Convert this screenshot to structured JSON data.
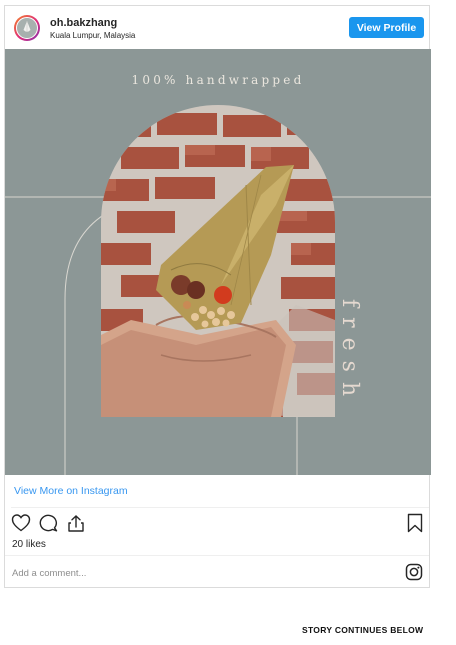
{
  "post": {
    "username": "oh.bakzhang",
    "location": "Kuala Lumpur, Malaysia",
    "view_profile_label": "View Profile",
    "image_text": {
      "tagline": "100% handwrapped",
      "side_word": "fresh"
    },
    "view_more_label": "View More on Instagram",
    "likes": "20 likes",
    "comment_placeholder": "Add a comment..."
  },
  "footer": {
    "story_continues": "STORY CONTINUES BELOW"
  },
  "icons": [
    "heart-icon",
    "comment-icon",
    "share-icon",
    "bookmark-icon",
    "instagram-icon"
  ],
  "colors": {
    "accent": "#1a96ee",
    "link": "#3897f0",
    "photo_background": "#8c9796"
  }
}
